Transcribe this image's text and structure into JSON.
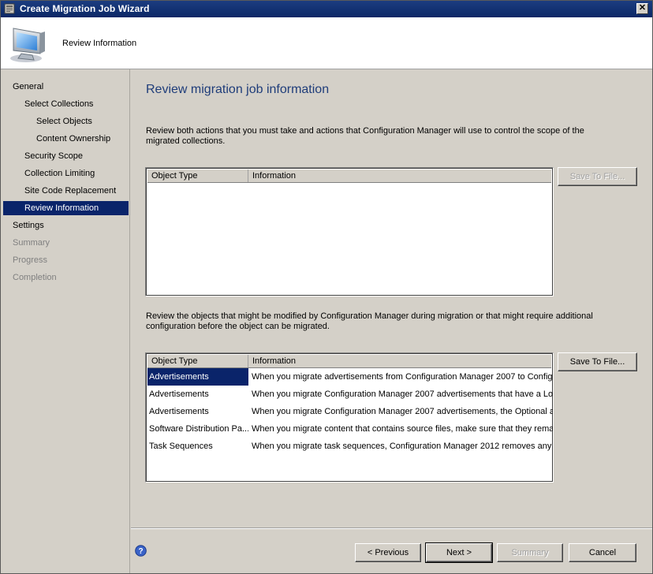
{
  "window": {
    "title": "Create Migration Job Wizard",
    "close_glyph": "✕"
  },
  "header": {
    "title": "Review Information",
    "icon": "computer-monitor-icon"
  },
  "nav": {
    "items": [
      {
        "label": "General",
        "level": 0,
        "state": "normal"
      },
      {
        "label": "Select Collections",
        "level": 1,
        "state": "normal"
      },
      {
        "label": "Select Objects",
        "level": 2,
        "state": "normal"
      },
      {
        "label": "Content Ownership",
        "level": 2,
        "state": "normal"
      },
      {
        "label": "Security Scope",
        "level": 1,
        "state": "normal"
      },
      {
        "label": "Collection Limiting",
        "level": 1,
        "state": "normal"
      },
      {
        "label": "Site Code Replacement",
        "level": 1,
        "state": "normal"
      },
      {
        "label": "Review Information",
        "level": 1,
        "state": "selected"
      },
      {
        "label": "Settings",
        "level": 0,
        "state": "normal"
      },
      {
        "label": "Summary",
        "level": 0,
        "state": "disabled"
      },
      {
        "label": "Progress",
        "level": 0,
        "state": "disabled"
      },
      {
        "label": "Completion",
        "level": 0,
        "state": "disabled"
      }
    ]
  },
  "main": {
    "heading": "Review migration job information",
    "desc1": "Review both actions that you must take and actions that Configuration Manager will use to control the scope of the migrated collections.",
    "desc2": "Review the objects that might be modified by Configuration Manager during migration or that might require additional configuration before the object can be migrated.",
    "list1": {
      "columns": [
        "Object Type",
        "Information"
      ],
      "rows": []
    },
    "list2": {
      "columns": [
        "Object Type",
        "Information"
      ],
      "rows": [
        {
          "type": "Advertisements",
          "info": "When you migrate advertisements from Configuration Manager 2007 to Configu...",
          "selected": true
        },
        {
          "type": "Advertisements",
          "info": "When you migrate Configuration Manager 2007 advertisements that have a Lo...",
          "selected": false
        },
        {
          "type": "Advertisements",
          "info": "When you migrate Configuration Manager 2007 advertisements, the Optional a...",
          "selected": false
        },
        {
          "type": "Software Distribution Pa...",
          "info": "When you migrate content that contains source files, make sure that they rema...",
          "selected": false
        },
        {
          "type": "Task Sequences",
          "info": "When you migrate task sequences, Configuration Manager 2012 removes any ...",
          "selected": false
        }
      ]
    },
    "save1_label": "Save To File...",
    "save1_enabled": false,
    "save2_label": "Save To File...",
    "save2_enabled": true
  },
  "footer": {
    "help_icon": "help-question-icon",
    "previous_label": "< Previous",
    "next_label": "Next >",
    "summary_label": "Summary",
    "cancel_label": "Cancel"
  }
}
